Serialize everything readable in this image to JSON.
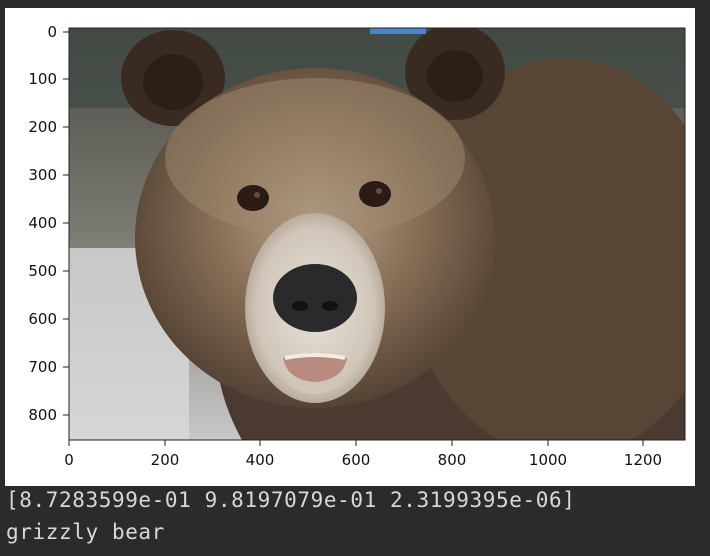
{
  "notebook_output": {
    "plot": {
      "y_ticks": [
        "0",
        "100",
        "200",
        "300",
        "400",
        "500",
        "600",
        "700",
        "800"
      ],
      "x_ticks": [
        "0",
        "200",
        "400",
        "600",
        "800",
        "1000",
        "1200"
      ],
      "image_subject": "grizzly bear face photograph"
    },
    "stdout": {
      "probabilities_line": "[8.7283599e-01 9.8197079e-01 2.3199395e-06]",
      "prediction_line": "grizzly bear"
    }
  },
  "colors": {
    "output_background": "#2b2b2b",
    "figure_background": "#ffffff",
    "overlay_bar": "#4c84c8",
    "stdout_text": "#d8d8d8"
  }
}
